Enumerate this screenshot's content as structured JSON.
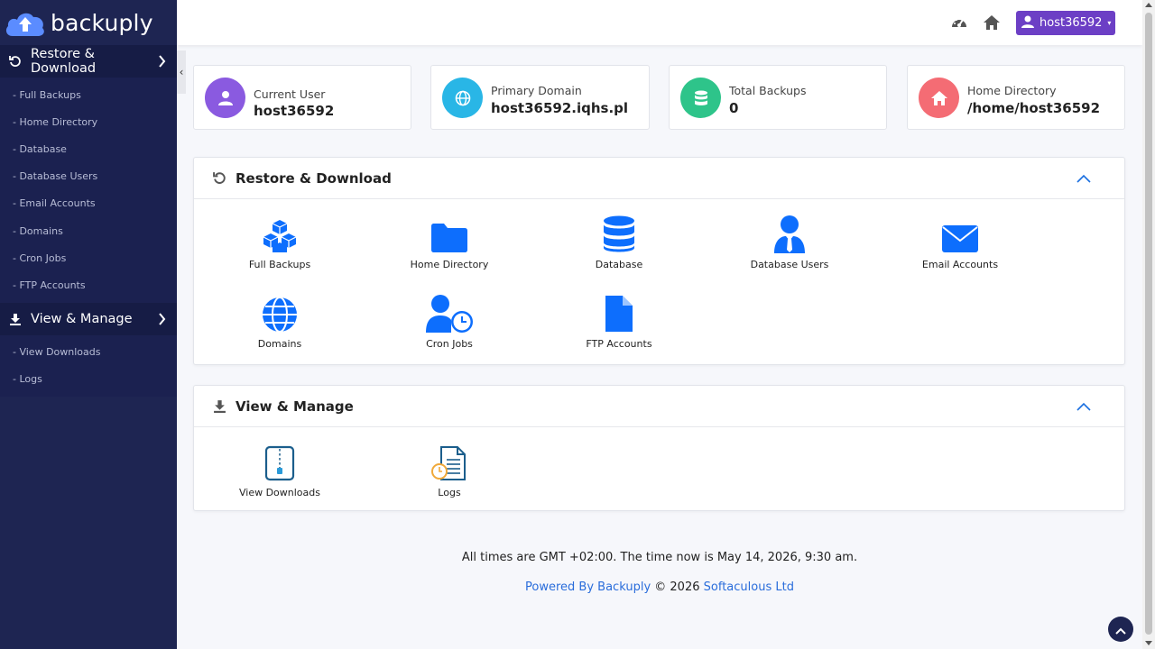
{
  "app": {
    "name": "backuply"
  },
  "sidebar": {
    "sections": [
      {
        "label": "Restore & Download",
        "icon": "restore-icon",
        "items": [
          "- Full Backups",
          "- Home Directory",
          "- Database",
          "- Database Users",
          "- Email Accounts",
          "- Domains",
          "- Cron Jobs",
          "- FTP Accounts"
        ]
      },
      {
        "label": "View & Manage",
        "icon": "download-icon",
        "items": [
          "- View Downloads",
          "- Logs"
        ]
      }
    ],
    "collapse_glyph": "‹"
  },
  "topbar": {
    "user_label": "host36592",
    "caret": "▾"
  },
  "cards": [
    {
      "label": "Current User",
      "value": "host36592",
      "color": "#8a5ae0",
      "icon": "user-icon"
    },
    {
      "label": "Primary Domain",
      "value": "host36592.iqhs.pl",
      "color": "#29b6e6",
      "icon": "globe-icon"
    },
    {
      "label": "Total Backups",
      "value": "0",
      "color": "#2ec48a",
      "icon": "database-icon"
    },
    {
      "label": "Home Directory",
      "value": "/home/host36592",
      "color": "#f46c74",
      "icon": "home-icon"
    }
  ],
  "panels": {
    "restore": {
      "title": "Restore & Download",
      "tiles": [
        "Full Backups",
        "Home Directory",
        "Database",
        "Database Users",
        "Email Accounts",
        "Domains",
        "Cron Jobs",
        "FTP Accounts"
      ]
    },
    "manage": {
      "title": "View & Manage",
      "tiles": [
        "View Downloads",
        "Logs"
      ]
    }
  },
  "footer": {
    "time_text": "All times are GMT +02:00. The time now is May 14, 2026, 9:30 am.",
    "powered_by": "Powered By Backuply",
    "copyright": "© 2026",
    "company": "Softaculous Ltd"
  },
  "colors": {
    "accent": "#0d6efd",
    "sidebar": "#1e2552",
    "user_button": "#6c3fc5"
  }
}
